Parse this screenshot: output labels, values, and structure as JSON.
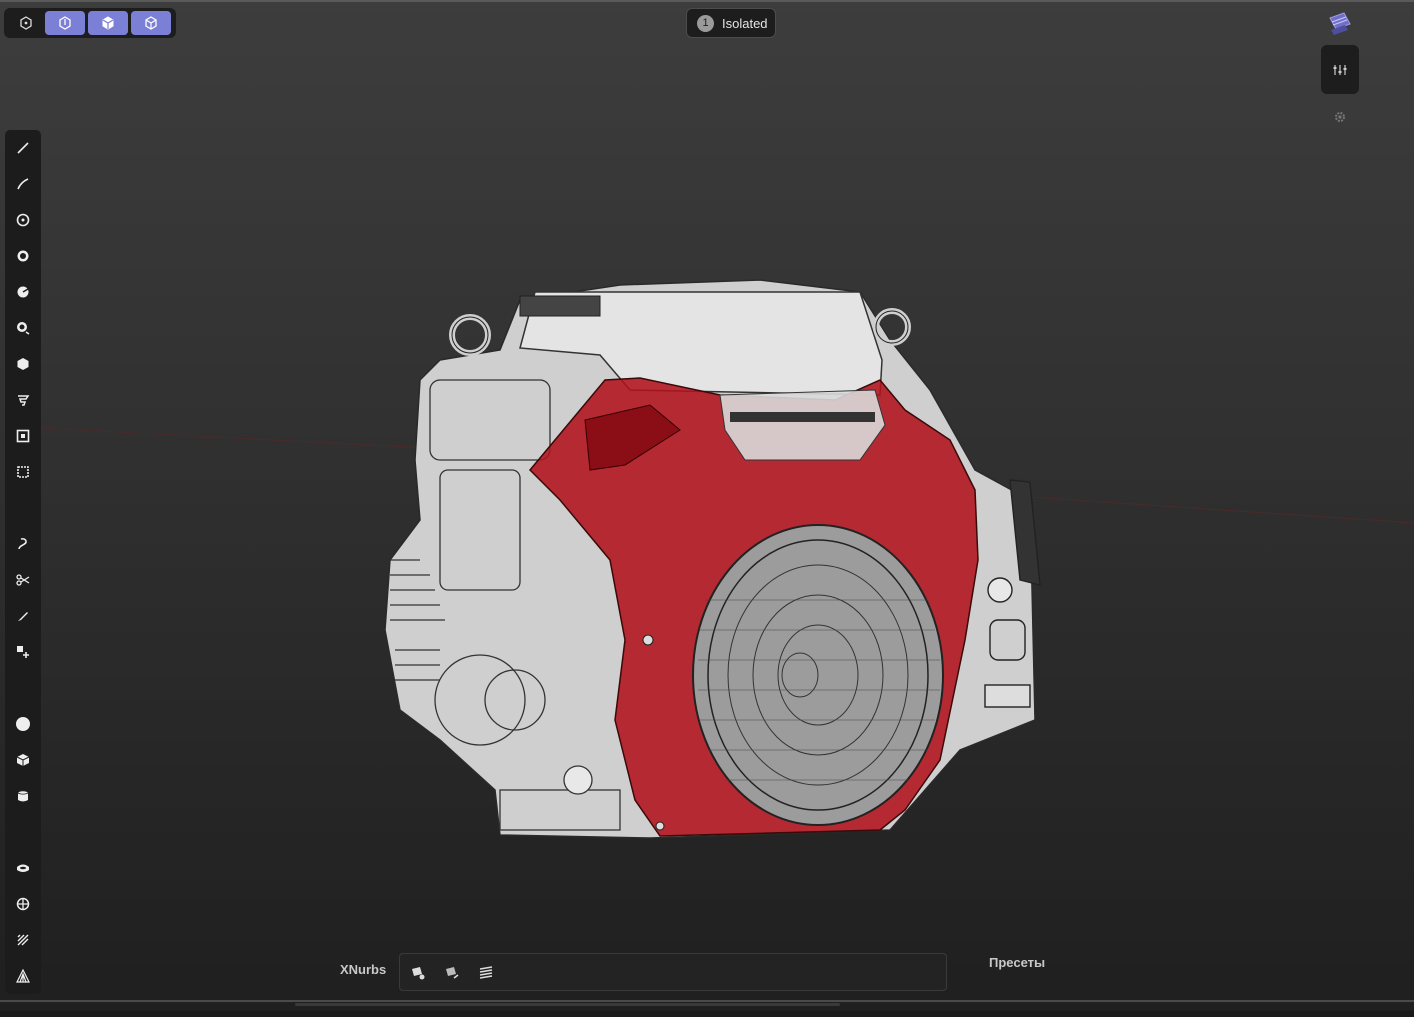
{
  "top_toolbar": {
    "isolated_count": "1",
    "isolated_label": "Isolated",
    "view_buttons": [
      "home-view-icon",
      "front-view-icon",
      "iso-view-icon",
      "box-view-icon"
    ]
  },
  "right_controls": {
    "icons": [
      "layers-icon",
      "sliders-icon",
      "gear-icon"
    ]
  },
  "left_toolbar": {
    "tools": [
      "line-icon",
      "polyline-icon",
      "point-icon",
      "circle-icon",
      "arc-icon",
      "curve-icon",
      "polygon-icon",
      "spiral-icon",
      "rectangle-icon",
      "frame-icon",
      "freeform-curve-icon",
      "scissors-icon",
      "pen-icon",
      "add-point-icon",
      "sphere-icon",
      "cube-icon",
      "cylinder-icon",
      "torus-icon",
      "boolean-icon",
      "rake-icon",
      "pattern-icon"
    ]
  },
  "bottom_bar": {
    "xnurbs_label": "XNurbs",
    "presets_label": "Пресеты",
    "tools": [
      "xnurbs-surface-icon",
      "xnurbs-surface-alt-icon",
      "xnurbs-layers-icon"
    ]
  },
  "colors": {
    "accent": "#7b7fd6",
    "panel": "#1d1d1d",
    "engine_shroud": "#b0121c"
  }
}
